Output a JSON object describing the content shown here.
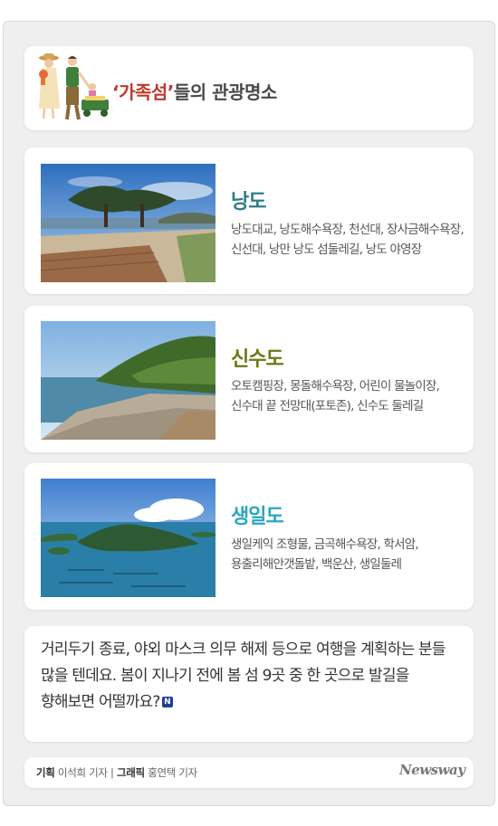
{
  "header": {
    "title_accent": "‘가족섬’",
    "title_rest": "들의 관광명소"
  },
  "places": [
    {
      "name": "낭도",
      "color": "#2e7d8a",
      "description": "낭도대교, 낭도해수욕장, 천선대, 장사금해수욕장, 신선대, 낭만 낭도 섬둘레길, 낭도 야영장"
    },
    {
      "name": "신수도",
      "color": "#6a7a12",
      "description": "오토캠핑장, 몽돌해수욕장, 어린이 물놀이장, 신수대 끝 전망대(포토존), 신수도 둘레길"
    },
    {
      "name": "생일도",
      "color": "#2aa7c0",
      "description": "생일케익 조형물, 금곡해수욕장, 학서암, 용출리해안갯돌밭, 백운산, 생일둘레"
    }
  ],
  "body_text": "거리두기 종료, 야외 마스크 의무 해제 등으로 여행을 계획하는 분들 많을 텐데요. 봄이 지나기 전에 봄 섬 9곳 중 한 곳으로 발길을 향해보면 어떨까요?",
  "badge": "N",
  "footer": {
    "plan_label": "기획",
    "plan_name": "이석희 기자",
    "separator": "|",
    "graphic_label": "그래픽",
    "graphic_name": "홍연택 기자",
    "logo": "Newsway"
  }
}
